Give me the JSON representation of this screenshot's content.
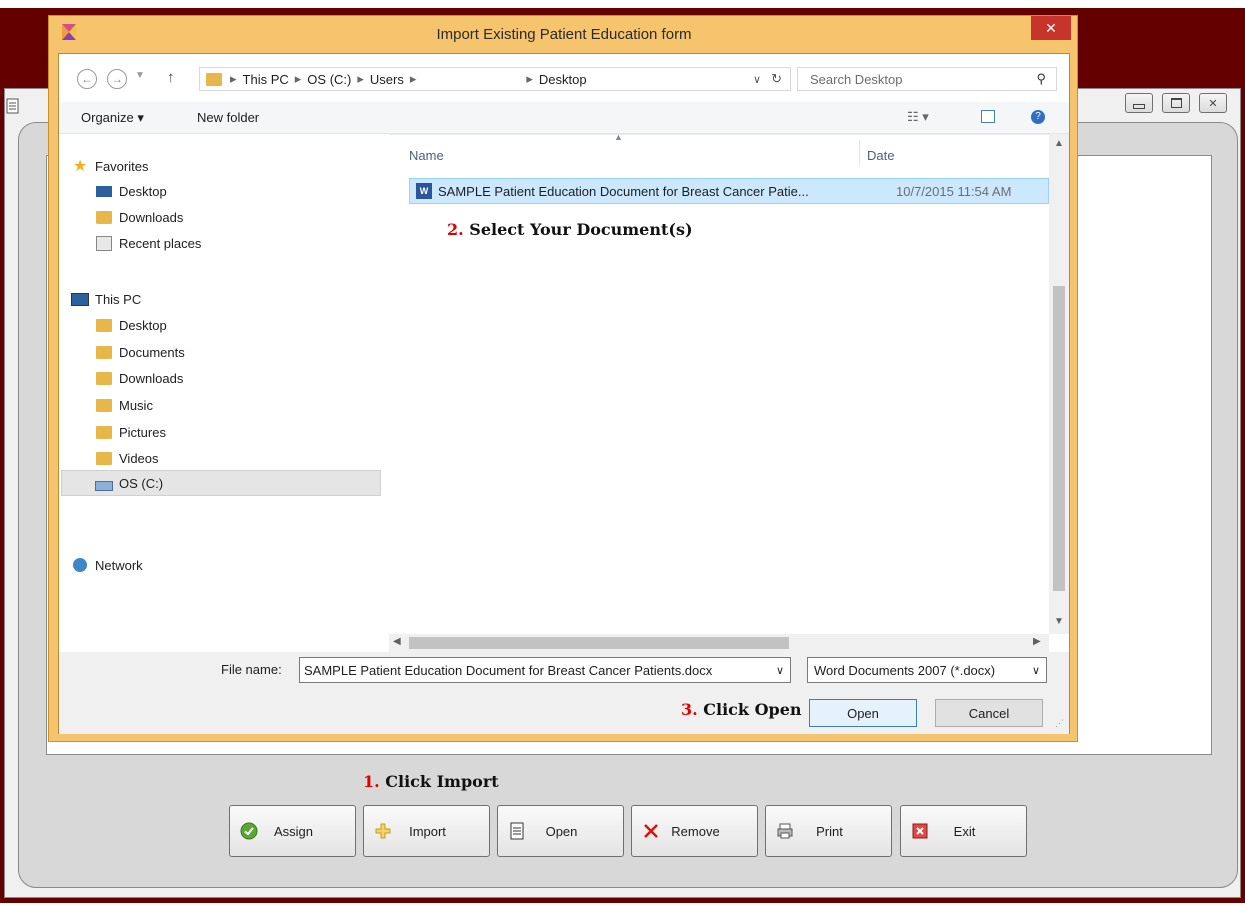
{
  "dialog": {
    "title": "Import Existing Patient Education form",
    "close_glyph": "✕",
    "address": {
      "segments": [
        "This PC",
        "OS (C:)",
        "Users",
        "",
        "Desktop"
      ],
      "search_placeholder": "Search Desktop"
    },
    "toolbar": {
      "organize": "Organize ▾",
      "new_folder": "New folder"
    },
    "nav": {
      "favorites": "Favorites",
      "fav_items": [
        "Desktop",
        "Downloads",
        "Recent places"
      ],
      "this_pc": "This PC",
      "pc_items": [
        "Desktop",
        "Documents",
        "Downloads",
        "Music",
        "Pictures",
        "Videos",
        "OS (C:)"
      ],
      "network": "Network"
    },
    "columns": {
      "name": "Name",
      "date": "Date"
    },
    "files": [
      {
        "name": "SAMPLE Patient Education Document for Breast Cancer Patie...",
        "date": "10/7/2015 11:54 AM"
      }
    ],
    "footer": {
      "file_name_label": "File name:",
      "file_name_value": "SAMPLE Patient Education Document for Breast Cancer Patients.docx",
      "file_type": "Word Documents 2007 (*.docx)",
      "open": "Open",
      "cancel": "Cancel"
    }
  },
  "annotations": {
    "step1_num": "1.",
    "step1_text": "Click Import",
    "step2_num": "2.",
    "step2_text": "Select Your Document(s)",
    "step3_num": "3.",
    "step3_text": "Click Open"
  },
  "app_buttons": [
    {
      "label": "Assign",
      "icon": "check-icon"
    },
    {
      "label": "Import",
      "icon": "import-plus-icon"
    },
    {
      "label": "Open",
      "icon": "document-icon"
    },
    {
      "label": "Remove",
      "icon": "x-icon"
    },
    {
      "label": "Print",
      "icon": "printer-icon"
    },
    {
      "label": "Exit",
      "icon": "exit-icon"
    }
  ],
  "colors": {
    "desktop": "#650000",
    "dialog_frame": "#f6c46c",
    "close": "#c7352a",
    "selection": "#cce8ff",
    "annot_number": "#e00000"
  }
}
